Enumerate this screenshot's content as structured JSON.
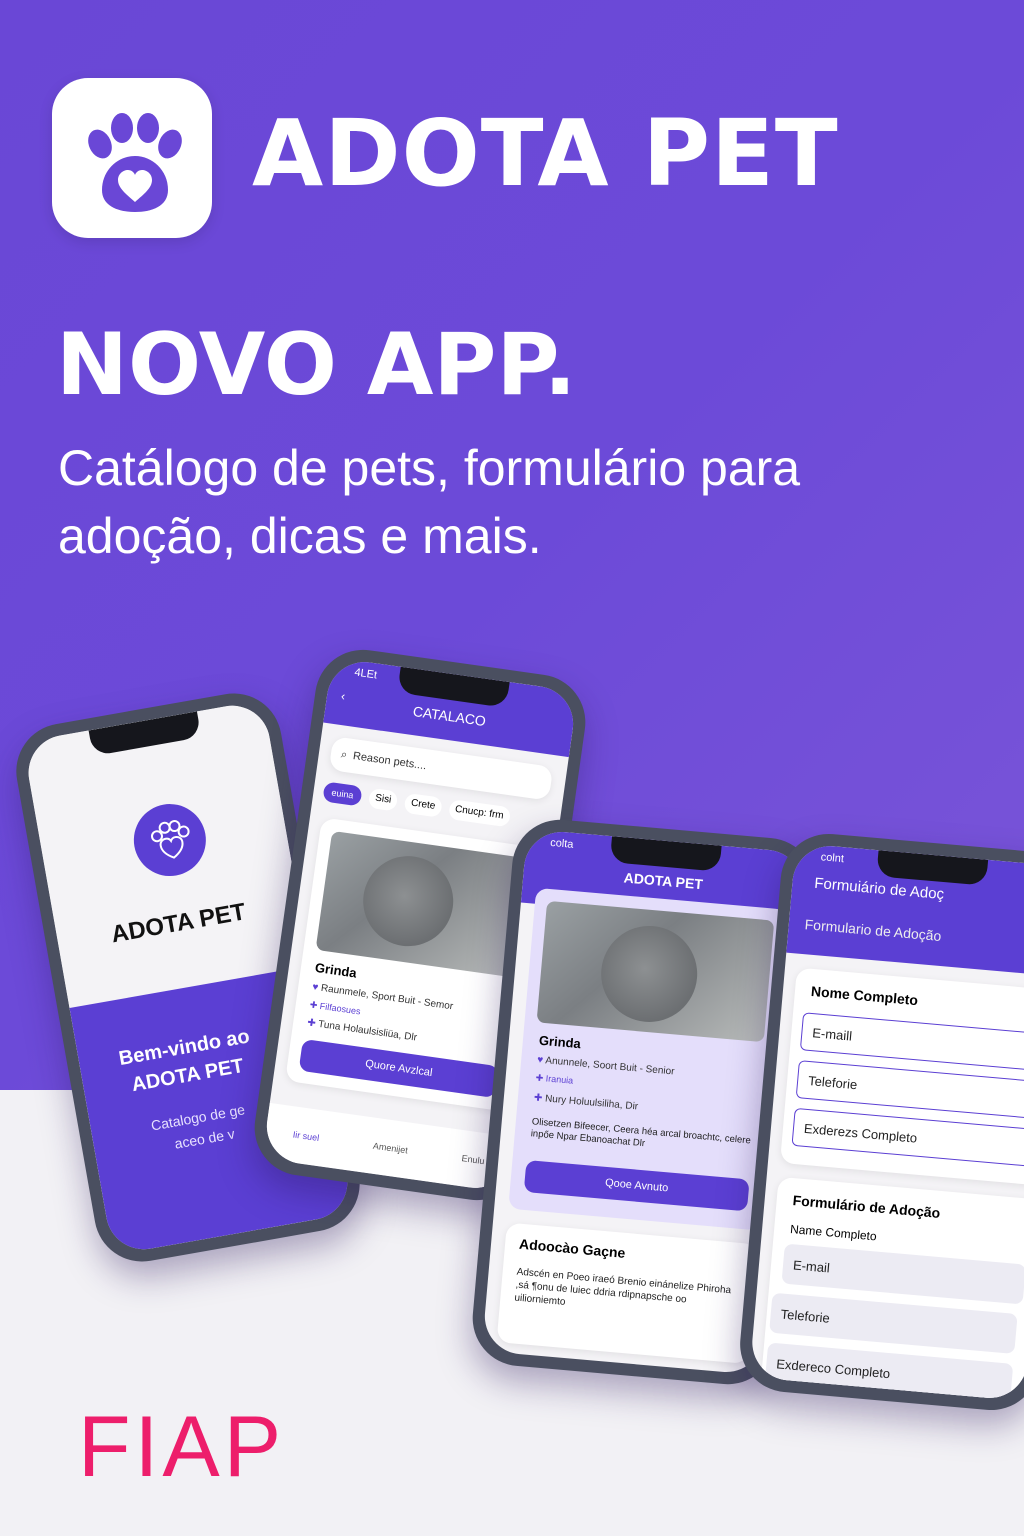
{
  "brand": {
    "name": "ADOTA PET"
  },
  "hero": {
    "headline": "NOVO APP.",
    "subheadline": "Catálogo de pets, formulário para adoção, dicas e mais."
  },
  "phone1": {
    "app_name": "ADOTA PET",
    "welcome_line1": "Bem-vindo ao",
    "welcome_line2": "ADOTA PET",
    "desc_line1": "Catalogo de ge",
    "desc_line2": "aceo de v"
  },
  "phone2": {
    "status_time": "4LEt",
    "header_title": "CATALACO",
    "search_placeholder": "Reason pets....",
    "chips": [
      "euina",
      "Sisi",
      "Crete",
      "Cnucp: frm"
    ],
    "pet_name": "Grinda",
    "pet_line1": "Raunmele, Sport Buit - Semor",
    "pet_line2": "Filfaosues",
    "pet_line3": "Tuna Holaulsisliüa, Dlr",
    "button": "Quore Avzlcal",
    "nav": [
      "Iir suel",
      "Amenijet",
      "Enulu"
    ]
  },
  "phone3": {
    "status_time": "colta",
    "header_title": "ADOTA PET",
    "pet_name": "Grinda",
    "pet_line1": "Anunnele, Soort Buit - Senior",
    "pet_line2": "Iranuia",
    "pet_line3": "Nury Holuulsiliha, Dir",
    "desc": "Olisetzen Bifeecer, Ceera héa arcal broachtc, celere inpőe Npar Ebanoachat Dlr",
    "button": "Qooe Avnuto",
    "section_title": "Adoocào Gaçne",
    "section_text": "Adscén en Poeo iraeó Brenio einánelize Phiroha ,sá ¶onu de luiec ddria rdipnapsche oo uiliorniemto"
  },
  "phone4": {
    "status_time": "colnt",
    "header_title": "Formuiário de Adoç",
    "header_subtitle": "Formulario de Adoção",
    "card1_title": "Nome Completo",
    "card1_fields": [
      "E-maill",
      "Teleforie",
      "Exderezs Completo"
    ],
    "card2_title": "Formulário de Adoção",
    "card2_label": "Name Completo",
    "card2_fields": [
      "E-mail",
      "Teleforie",
      "Exdereco Completo"
    ]
  },
  "footer": {
    "logo": "FIAP"
  },
  "colors": {
    "primary": "#6a47d6",
    "button": "#5b3fd3",
    "fiap": "#ed1e6b",
    "light": "#f2f1f5"
  }
}
